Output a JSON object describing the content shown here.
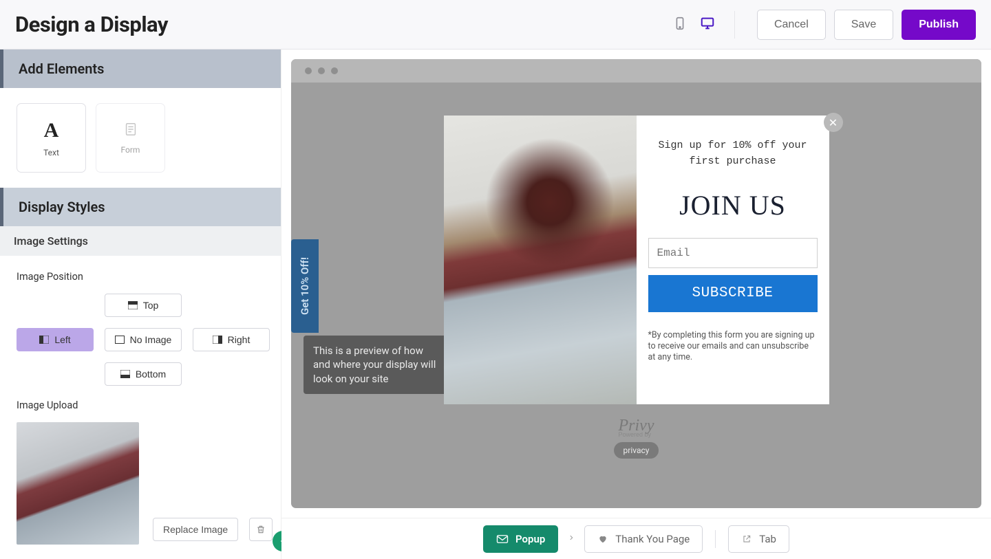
{
  "header": {
    "title": "Design a Display",
    "cancel": "Cancel",
    "save": "Save",
    "publish": "Publish"
  },
  "sidebar": {
    "add_elements": "Add Elements",
    "elements": {
      "text": "Text",
      "form": "Form"
    },
    "display_styles": "Display Styles",
    "image_settings": "Image Settings",
    "image_position_label": "Image Position",
    "positions": {
      "top": "Top",
      "left": "Left",
      "no_image": "No Image",
      "right": "Right",
      "bottom": "Bottom",
      "selected": "left"
    },
    "image_upload_label": "Image Upload",
    "replace": "Replace Image"
  },
  "canvas": {
    "side_tab": "Get 10% Off!",
    "preview_note": "This is a preview of how and where your display will look on your site"
  },
  "popup": {
    "intro": "Sign up for 10% off your first purchase",
    "hero": "JOIN US",
    "email_placeholder": "Email",
    "subscribe": "SUBSCRIBE",
    "disclaimer": "*By completing this form you are signing up to receive our emails and can unsubscribe at any time."
  },
  "badge": {
    "brand": "Privy",
    "powered_by": "Powered by",
    "privacy": "privacy"
  },
  "bottom_bar": {
    "popup": "Popup",
    "thank_you": "Thank You Page",
    "tab": "Tab"
  }
}
